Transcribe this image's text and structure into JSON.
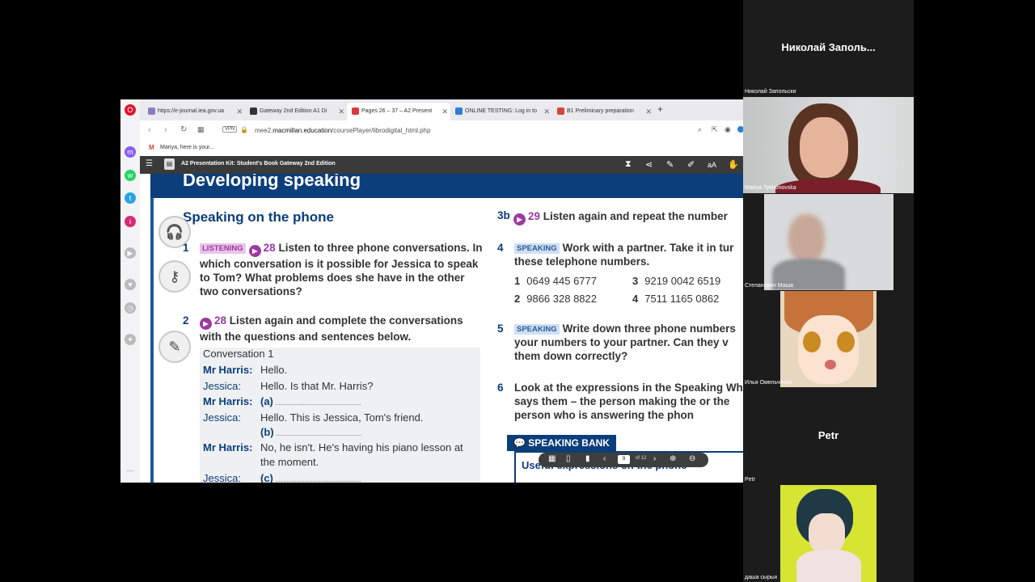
{
  "browser": {
    "tabs": [
      {
        "title": "https://e-journal.iea.gov.ua"
      },
      {
        "title": "Gateway 2nd Edition A1 Di"
      },
      {
        "title": "Pages 26 – 37 – A2 Present"
      },
      {
        "title": "ONLINE TESTING: Log in to"
      },
      {
        "title": "B1 Preliminary preparation"
      }
    ],
    "url_prefix": "mee2.",
    "url_domain": "macmillan.education",
    "url_path": "/coursePlayer/librodigital_html.php",
    "vpn": "VPN",
    "bookmark": "Mariya, here is your..."
  },
  "app": {
    "title": "A2 Presentation Kit: Student's Book Gateway 2nd Edition"
  },
  "page": {
    "banner": "Developing speaking",
    "heading": "Speaking on the phone",
    "q1": {
      "num": "1",
      "tag": "LISTENING",
      "track": "28",
      "text": "Listen to three phone conversations. In which conversation is it possible for Jessica to speak to Tom? What problems does she have in the other two conversations?"
    },
    "q2": {
      "num": "2",
      "track": "28",
      "text": "Listen again and complete the conversations with the questions and sentences below."
    },
    "conversation": {
      "title": "Conversation 1",
      "lines": [
        {
          "speaker": "Mr Harris:",
          "text": "Hello."
        },
        {
          "speaker": "Jessica:",
          "text": "Hello. Is that Mr. Harris?"
        },
        {
          "speaker": "Mr Harris:",
          "text": "(a)"
        },
        {
          "speaker": "Jessica:",
          "text": "Hello. This is Jessica, Tom's friend."
        },
        {
          "speaker": "",
          "text": "(b)"
        },
        {
          "speaker": "Mr Harris:",
          "text": "No, he isn't. He's having his piano lesson at"
        },
        {
          "speaker": "",
          "text": "the moment."
        },
        {
          "speaker": "Jessica:",
          "text": "(c)"
        }
      ]
    },
    "q3b": {
      "num": "3b",
      "track": "29",
      "text": "Listen again and repeat the number"
    },
    "q4": {
      "num": "4",
      "tag": "SPEAKING",
      "text": "Work with a partner. Take it in tur these telephone numbers."
    },
    "phone_numbers": [
      {
        "n": "1",
        "v": "0649 445 6777"
      },
      {
        "n": "3",
        "v": "9219 0042 6519"
      },
      {
        "n": "2",
        "v": "9866 328 8822"
      },
      {
        "n": "4",
        "v": "7511 1165 0862"
      }
    ],
    "q5": {
      "num": "5",
      "tag": "SPEAKING",
      "text": "Write down three phone numbers your numbers to your partner. Can they v them down correctly?"
    },
    "q6": {
      "num": "6",
      "text": "Look at the expressions in the Speaking Who says them – the person making the or the person who is answering the phon"
    },
    "speaking_bank": "SPEAKING BANK",
    "useful": "Useful expressions on the phone"
  },
  "pager": {
    "current": "9",
    "of": "of 12"
  },
  "participants": {
    "top_header": "Николай  Заполь...",
    "top_label": "Николай Запольски",
    "p1": "Mariya Tykhonovska",
    "p2": "Степанович Маша",
    "p3": "Илья Омельченко",
    "p4_header": "Petr",
    "p4_label": "Petr",
    "p5": "даша сырых"
  }
}
